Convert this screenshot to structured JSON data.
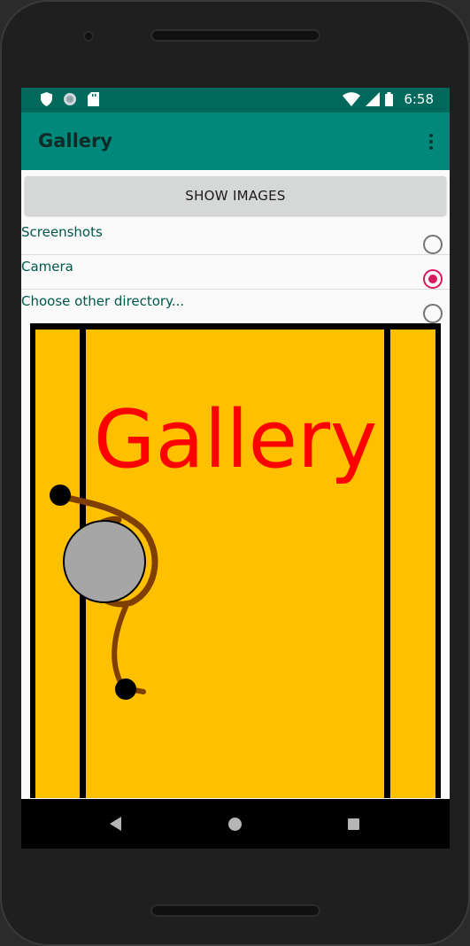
{
  "status_bar": {
    "time": "6:58",
    "icons_left": [
      "shield-icon",
      "sync-icon",
      "sd-card-icon"
    ],
    "icons_right": [
      "wifi-icon",
      "signal-icon",
      "battery-icon"
    ]
  },
  "app_bar": {
    "title": "Gallery",
    "overflow_icon": "more-vert-icon"
  },
  "show_button": {
    "label": "SHOW IMAGES"
  },
  "directories": [
    {
      "label": "Screenshots",
      "checked": false
    },
    {
      "label": "Camera",
      "checked": true
    },
    {
      "label": "Choose other directory...",
      "checked": false
    }
  ],
  "image": {
    "text": "Gallery",
    "background": "#ffc000",
    "text_color": "#ff0000"
  },
  "colors": {
    "status_bar": "#00695c",
    "app_bar": "#00897b",
    "accent": "#d81b60"
  },
  "nav_bar": {
    "icons": [
      "back-icon",
      "home-icon",
      "recents-icon"
    ]
  }
}
